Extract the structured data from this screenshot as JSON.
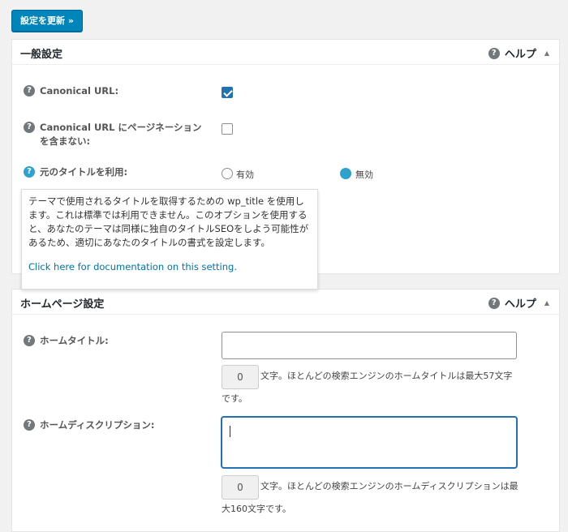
{
  "toolbar": {
    "update_label": "設定を更新 »"
  },
  "general": {
    "title": "一般設定",
    "help_label": "ヘルプ",
    "canonical_label": "Canonical URL:",
    "no_pagination_label_line1": "Canonical URL にページネーション",
    "no_pagination_label_line2": "を含まない:",
    "original_title_label": "元のタイトルを利用:",
    "radio_enabled": "有効",
    "radio_disabled": "無効",
    "canonical_checked": true,
    "no_pagination_checked": false,
    "original_title_selected": "無効"
  },
  "tooltip": {
    "text": "テーマで使用されるタイトルを取得するための wp_title を使用します。これは標準では利用できません。このオプションを使用すると、あなたのテーマは同様に独自のタイトルSEOをしよう可能性があるため、適切にあなたのタイトルの書式を設定します。",
    "link": "Click here for documentation on this setting."
  },
  "home": {
    "title": "ホームページ設定",
    "help_label": "ヘルプ",
    "home_title_label": "ホームタイトル:",
    "home_title_value": "",
    "home_title_count": "0",
    "home_title_hint_line1": "文字。ほとんどの検索エンジンのホームタイトルは最大57文字",
    "home_title_hint_line2": "です。",
    "home_desc_label": "ホームディスクリプション:",
    "home_desc_value": "",
    "home_desc_count": "0",
    "home_desc_hint_line1": "文字。ほとんどの検索エンジンのホームディスクリプションは最",
    "home_desc_hint_line2": "大160文字です。"
  }
}
